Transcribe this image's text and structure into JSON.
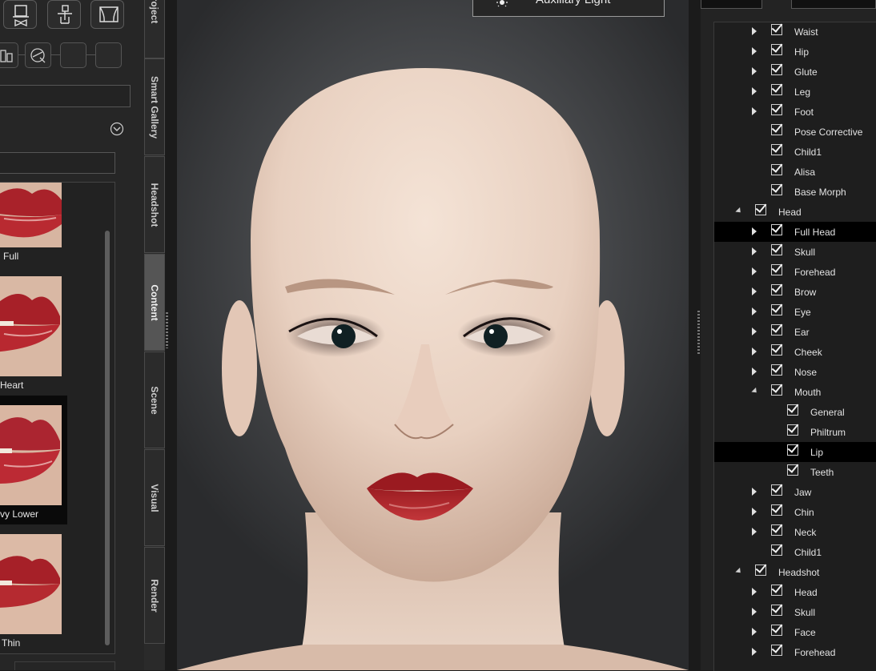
{
  "tabs": [
    "roject",
    "Smart Gallery",
    "Headshot",
    "Content",
    "Scene",
    "Visual",
    "Render"
  ],
  "active_tab": "Content",
  "viewport": {
    "aux_light_label": "Auxiliary Light"
  },
  "thumbnails": [
    {
      "label": "Full"
    },
    {
      "label": "Heart"
    },
    {
      "label": "vy Lower"
    },
    {
      "label": "Thin"
    }
  ],
  "tree": [
    {
      "label": "Waist",
      "level": 2,
      "expander": "right"
    },
    {
      "label": "Hip",
      "level": 2,
      "expander": "right"
    },
    {
      "label": "Glute",
      "level": 2,
      "expander": "right"
    },
    {
      "label": "Leg",
      "level": 2,
      "expander": "right"
    },
    {
      "label": "Foot",
      "level": 2,
      "expander": "right"
    },
    {
      "label": "Pose Corrective",
      "level": 2,
      "expander": "none"
    },
    {
      "label": "Child1",
      "level": 2,
      "expander": "none"
    },
    {
      "label": "Alisa",
      "level": 2,
      "expander": "none"
    },
    {
      "label": "Base Morph",
      "level": 2,
      "expander": "none"
    },
    {
      "label": "Head",
      "level": 1,
      "expander": "down"
    },
    {
      "label": "Full Head",
      "level": 2,
      "expander": "right",
      "highlight": true
    },
    {
      "label": "Skull",
      "level": 2,
      "expander": "right"
    },
    {
      "label": "Forehead",
      "level": 2,
      "expander": "right"
    },
    {
      "label": "Brow",
      "level": 2,
      "expander": "right"
    },
    {
      "label": "Eye",
      "level": 2,
      "expander": "right"
    },
    {
      "label": "Ear",
      "level": 2,
      "expander": "right"
    },
    {
      "label": "Cheek",
      "level": 2,
      "expander": "right"
    },
    {
      "label": "Nose",
      "level": 2,
      "expander": "right"
    },
    {
      "label": "Mouth",
      "level": 2,
      "expander": "down"
    },
    {
      "label": "General",
      "level": 3,
      "expander": "none"
    },
    {
      "label": "Philtrum",
      "level": 3,
      "expander": "none"
    },
    {
      "label": "Lip",
      "level": 3,
      "expander": "none",
      "highlight": true
    },
    {
      "label": "Teeth",
      "level": 3,
      "expander": "none"
    },
    {
      "label": "Jaw",
      "level": 2,
      "expander": "right"
    },
    {
      "label": "Chin",
      "level": 2,
      "expander": "right"
    },
    {
      "label": "Neck",
      "level": 2,
      "expander": "right"
    },
    {
      "label": "Child1",
      "level": 2,
      "expander": "none"
    },
    {
      "label": "Headshot",
      "level": 1,
      "expander": "down"
    },
    {
      "label": "Head",
      "level": 2,
      "expander": "right"
    },
    {
      "label": "Skull",
      "level": 2,
      "expander": "right"
    },
    {
      "label": "Face",
      "level": 2,
      "expander": "right"
    },
    {
      "label": "Forehead",
      "level": 2,
      "expander": "right"
    }
  ]
}
